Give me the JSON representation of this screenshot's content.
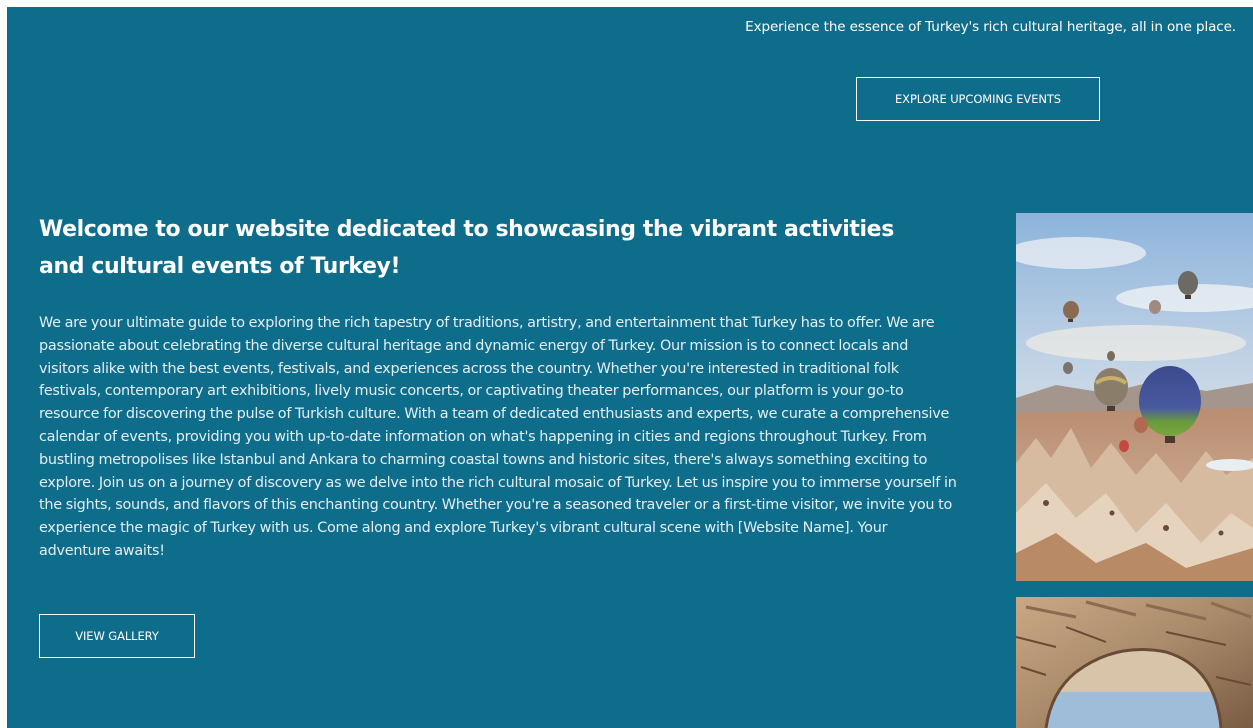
{
  "header": {
    "tagline": "Experience the essence of Turkey's rich cultural heritage, all in one place.",
    "explore_button": "EXPLORE UPCOMING EVENTS"
  },
  "welcome": {
    "title": "Welcome to our website dedicated to showcasing the vibrant activities and cultural events of Turkey!",
    "body": "We are your ultimate guide to exploring the rich tapestry of traditions, artistry, and entertainment that Turkey has to offer. We are passionate about celebrating the diverse cultural heritage and dynamic energy of Turkey. Our mission is to connect locals and visitors alike with the best events, festivals, and experiences across the country. Whether you're interested in traditional folk festivals, contemporary art exhibitions, lively music concerts, or captivating theater performances, our platform is your go-to resource for discovering the pulse of Turkish culture. With a team of dedicated enthusiasts and experts, we curate a comprehensive calendar of events, providing you with up-to-date information on what's happening in cities and regions throughout Turkey. From bustling metropolises like Istanbul and Ankara to charming coastal towns and historic sites, there's always something exciting to explore. Join us on a journey of discovery as we delve into the rich cultural mosaic of Turkey. Let us inspire you to immerse yourself in the sights, sounds, and flavors of this enchanting country. Whether you're a seasoned traveler or a first-time visitor, we invite you to experience the magic of Turkey with us. Come along and explore Turkey's vibrant cultural scene with [Website Name]. Your adventure awaits!",
    "gallery_button": "VIEW GALLERY"
  },
  "colors": {
    "background": "#0f6d8c",
    "text": "#ffffff",
    "body_text": "#e3eef2"
  }
}
